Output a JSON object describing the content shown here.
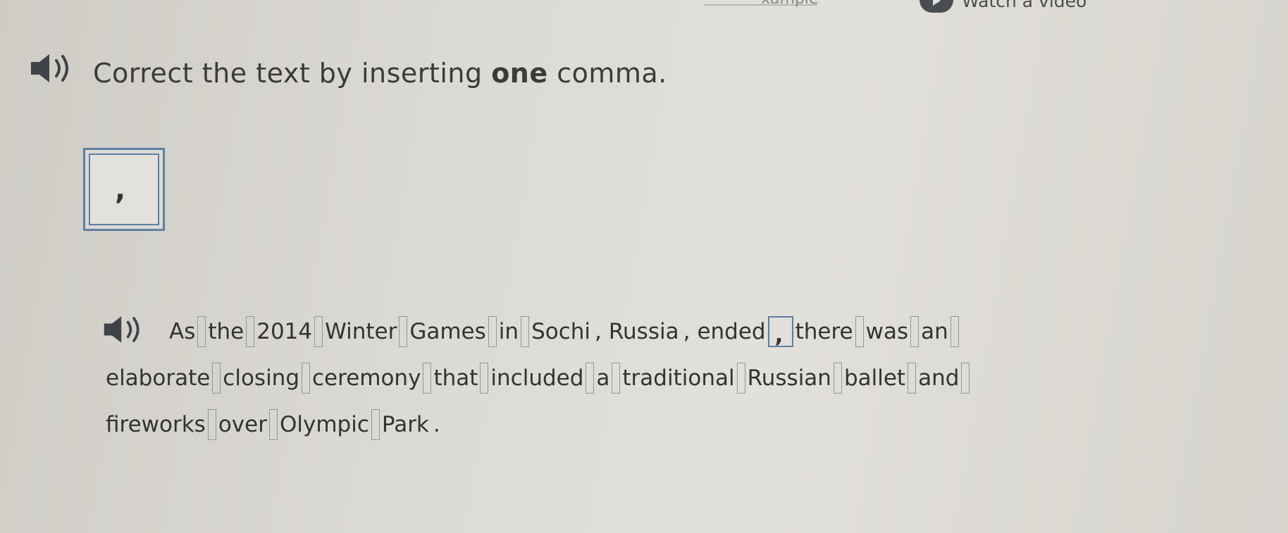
{
  "header": {
    "example_label": "xample",
    "video_label": "Watch a video"
  },
  "instruction": {
    "before": "Correct the text by inserting",
    "emphasis": "one",
    "after": "comma."
  },
  "comma_tile": {
    "glyph": ","
  },
  "passage": {
    "lines": [
      [
        {
          "w": "As"
        },
        {
          "s": ""
        },
        {
          "w": "the"
        },
        {
          "s": ""
        },
        {
          "w": "2014"
        },
        {
          "s": ""
        },
        {
          "w": "Winter"
        },
        {
          "s": ""
        },
        {
          "w": "Games"
        },
        {
          "s": ""
        },
        {
          "w": "in"
        },
        {
          "s": ""
        },
        {
          "w": "Sochi"
        },
        {
          "p": ","
        },
        {
          "w": "Russia"
        },
        {
          "p": ","
        },
        {
          "w": "ended"
        },
        {
          "s": ",",
          "filled": true
        },
        {
          "w": "there"
        },
        {
          "s": ""
        },
        {
          "w": "was"
        },
        {
          "s": ""
        },
        {
          "w": "an"
        },
        {
          "s": ""
        }
      ],
      [
        {
          "w": "elaborate"
        },
        {
          "s": ""
        },
        {
          "w": "closing"
        },
        {
          "s": ""
        },
        {
          "w": "ceremony"
        },
        {
          "s": ""
        },
        {
          "w": "that"
        },
        {
          "s": ""
        },
        {
          "w": "included"
        },
        {
          "s": ""
        },
        {
          "w": "a"
        },
        {
          "s": ""
        },
        {
          "w": "traditional"
        },
        {
          "s": ""
        },
        {
          "w": "Russian"
        },
        {
          "s": ""
        },
        {
          "w": "ballet"
        },
        {
          "s": ""
        },
        {
          "w": "and"
        },
        {
          "s": ""
        }
      ],
      [
        {
          "w": "fireworks"
        },
        {
          "s": ""
        },
        {
          "w": "over"
        },
        {
          "s": ""
        },
        {
          "w": "Olympic"
        },
        {
          "s": ""
        },
        {
          "w": "Park"
        },
        {
          "p": "."
        }
      ]
    ]
  },
  "colors": {
    "slot_border": "#8a98aa",
    "tile_border": "#5d7fa6",
    "speaker": "#3f4247"
  }
}
